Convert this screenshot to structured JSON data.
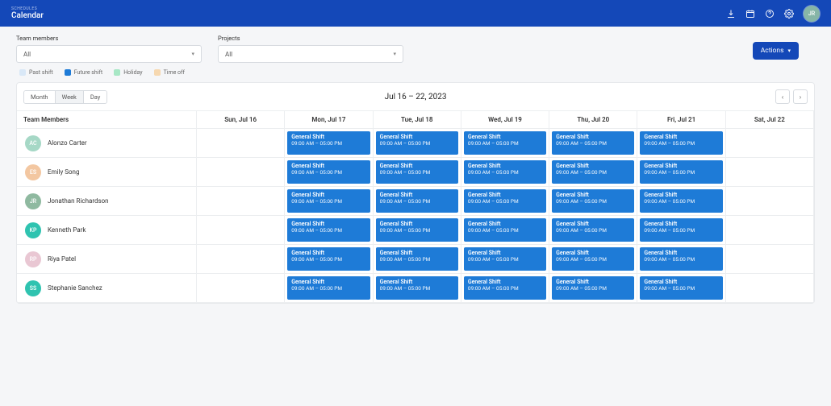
{
  "header": {
    "crumb": "SCHEDULES",
    "title": "Calendar",
    "avatar_initials": "JR"
  },
  "filters": {
    "team_members": {
      "label": "Team members",
      "value": "All"
    },
    "projects": {
      "label": "Projects",
      "value": "All"
    }
  },
  "actions_label": "Actions",
  "legend": [
    {
      "label": "Past shift",
      "color": "#d9e8f7"
    },
    {
      "label": "Future shift",
      "color": "#1e7bd7"
    },
    {
      "label": "Holiday",
      "color": "#a7e7c5"
    },
    {
      "label": "Time off",
      "color": "#f6d8b0"
    }
  ],
  "view": {
    "options": [
      "Month",
      "Week",
      "Day"
    ],
    "active": "Week"
  },
  "range_label": "Jul 16 – 22, 2023",
  "columns_header": "Team Members",
  "days": [
    "Sun, Jul 16",
    "Mon, Jul 17",
    "Tue, Jul 18",
    "Wed, Jul 19",
    "Thu, Jul 20",
    "Fri, Jul 21",
    "Sat, Jul 22"
  ],
  "shift": {
    "title": "General Shift",
    "time": "09:00 AM – 05:00 PM"
  },
  "members": [
    {
      "initials": "AC",
      "name": "Alonzo Carter",
      "color": "#a6d8c6",
      "shift_days": [
        1,
        2,
        3,
        4,
        5
      ]
    },
    {
      "initials": "ES",
      "name": "Emily Song",
      "color": "#f3c7a1",
      "shift_days": [
        1,
        2,
        3,
        4,
        5
      ]
    },
    {
      "initials": "JR",
      "name": "Jonathan Richardson",
      "color": "#8fb9a0",
      "shift_days": [
        1,
        2,
        3,
        4,
        5
      ]
    },
    {
      "initials": "KP",
      "name": "Kenneth Park",
      "color": "#2fc3b0",
      "shift_days": [
        1,
        2,
        3,
        4,
        5
      ]
    },
    {
      "initials": "RP",
      "name": "Riya Patel",
      "color": "#e9c7d3",
      "shift_days": [
        1,
        2,
        3,
        4,
        5
      ]
    },
    {
      "initials": "SS",
      "name": "Stephanie Sanchez",
      "color": "#2fc3b0",
      "shift_days": [
        1,
        2,
        3,
        4,
        5
      ]
    }
  ]
}
